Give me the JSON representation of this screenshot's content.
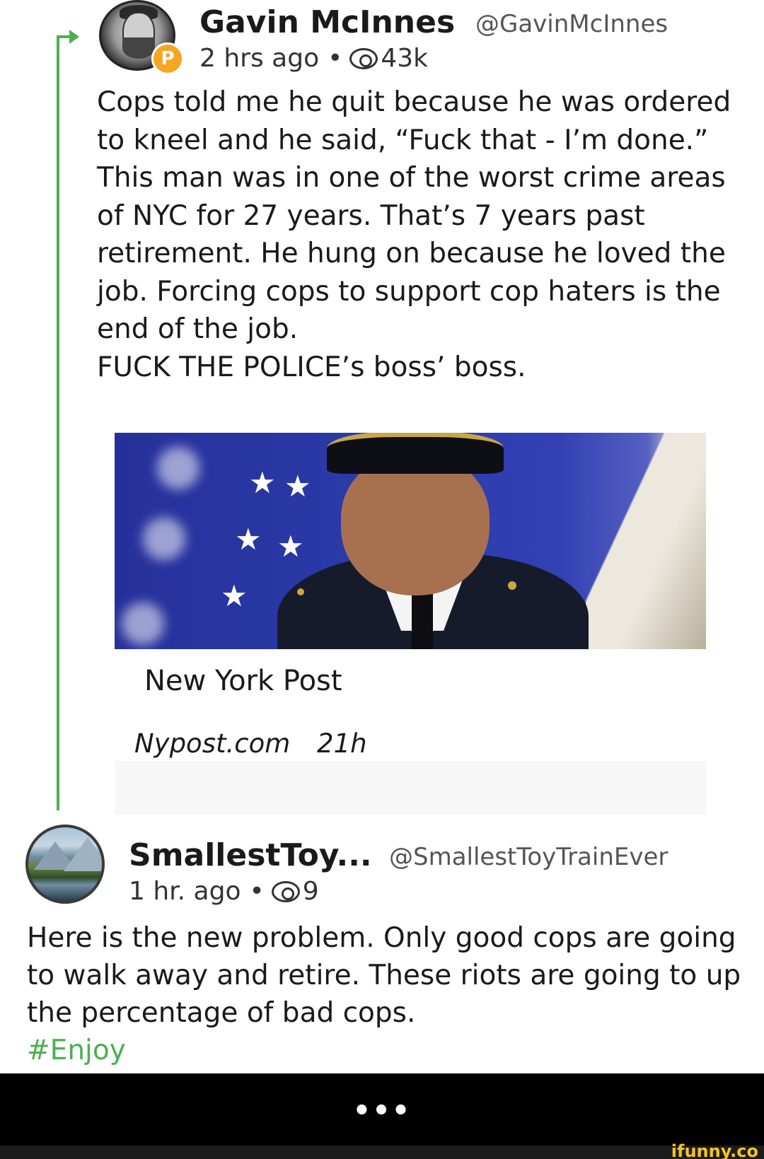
{
  "post1": {
    "author_name": "Gavin McInnes",
    "handle": "@GavinMcInnes",
    "time": "2 hrs ago",
    "separator": "•",
    "views": "43k",
    "badge_letter": "P",
    "text": "Cops told me he quit because he was ordered to kneel and he said, “Fuck that - I’m done.” This man was in one of the worst crime areas of NYC for 27 years. That’s 7 years past retirement. He hung on because he loved the job. Forcing cops to support cop haters is the end of the job.\nFUCK THE POLICE’s boss’ boss.",
    "link": {
      "title": "New York Post",
      "source": "Nypost.com",
      "age": "21h"
    }
  },
  "post2": {
    "author_name": "SmallestToy...",
    "handle": "@SmallestToyTrainEver",
    "time": "1 hr. ago",
    "separator": "•",
    "views": "9",
    "text": "Here is the new problem. Only good cops are going to walk away and retire. These riots are going to up the percentage of bad cops.",
    "hashtag": "#Enjoy"
  },
  "footer": {
    "more_dots": "•••",
    "watermark": "ifunny.co"
  },
  "colors": {
    "thread_line": "#4caf50",
    "hashtag": "#4caf50",
    "badge": "#f5a623",
    "watermark": "#f5c518"
  },
  "icons": [
    "reply-arrow-icon",
    "eye-icon",
    "verified-badge-icon"
  ]
}
